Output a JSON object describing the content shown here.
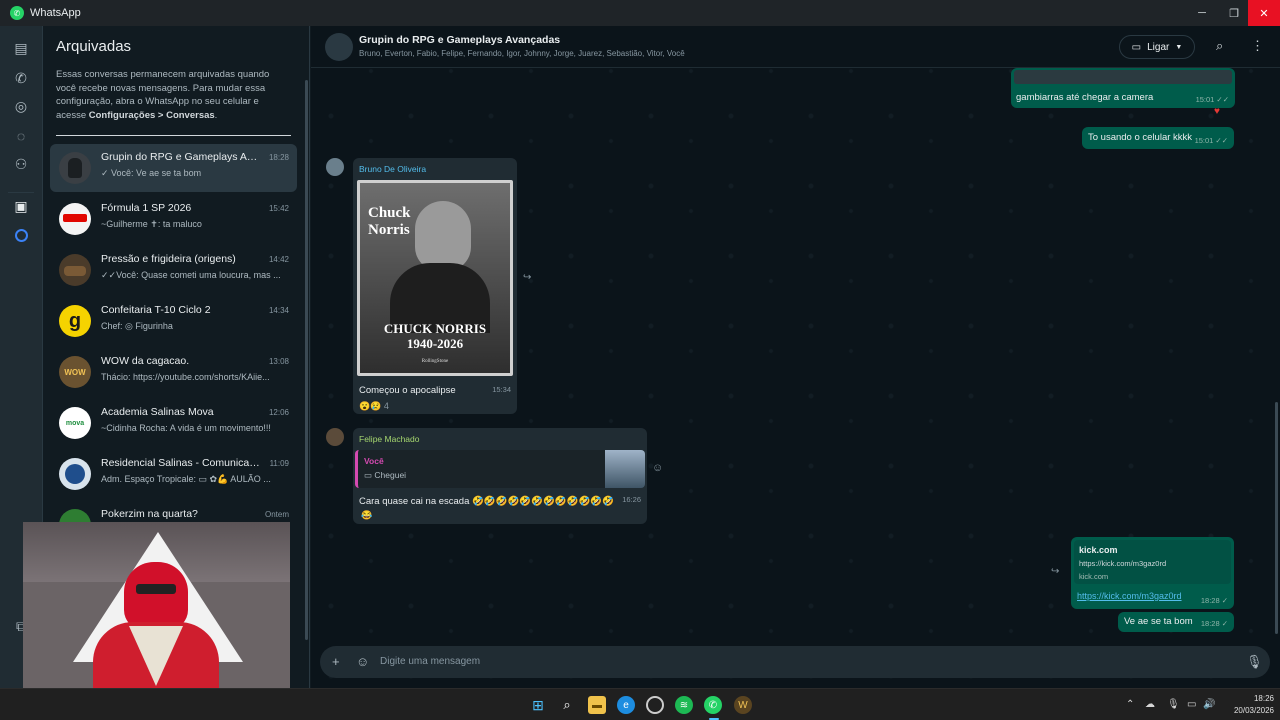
{
  "window": {
    "title": "WhatsApp"
  },
  "sidebar": {
    "title": "Arquivadas",
    "info_text": "Essas conversas permanecem arquivadas quando você recebe novas mensagens. Para mudar essa configuração, abra o WhatsApp no seu celular e acesse ",
    "info_bold": "Configurações > Conversas",
    "info_end": ".",
    "chats": [
      {
        "name": "Grupin do RPG e Gameplays Ava...",
        "time": "18:28",
        "last": "✓ Você: Ve ae se ta bom"
      },
      {
        "name": "Fórmula 1 SP 2026",
        "time": "15:42",
        "last": "~Guilherme ✝: ta maluco"
      },
      {
        "name": "Pressão e frigideira (origens)",
        "time": "14:42",
        "last": "✓✓Você: Quase cometi uma loucura, mas ..."
      },
      {
        "name": "Confeitaria T-10 Ciclo 2",
        "time": "14:34",
        "last": "Chef: ◎ Figurinha"
      },
      {
        "name": "WOW da cagacao.",
        "time": "13:08",
        "last": "Thácio: https://youtube.com/shorts/KAiie..."
      },
      {
        "name": "Academia Salinas Mova",
        "time": "12:06",
        "last": "~Cidinha Rocha: A vida é um movimento!!!"
      },
      {
        "name": "Residencial Salinas - Comunicad...",
        "time": "11:09",
        "last": "Adm. Espaço Tropicale: ▭ ✿💪 AULÃO ..."
      },
      {
        "name": "Pokerzim na quarta?",
        "time": "Ontem",
        "last": ""
      }
    ]
  },
  "header": {
    "group_name": "Grupin do RPG e Gameplays Avançadas",
    "members": "Bruno, Everton, Fabio, Felipe, Fernando, Igor, Johnny, Jorge, Juarez, Sebastião, Vitor, Você",
    "call_label": "Ligar"
  },
  "messages": {
    "m1_text": "gambiarras até chegar a camera",
    "m1_time": "15:01 ✓✓",
    "m2_text": "To usando o celular kkkk",
    "m2_time": "15:01 ✓✓",
    "m3_sender": "Bruno De Oliveira",
    "m3_poster_title1": "Chuck",
    "m3_poster_title2": "Norris",
    "m3_poster_caption1": "CHUCK NORRIS",
    "m3_poster_caption2": "1940-2026",
    "m3_poster_brand": "RollingStone",
    "m3_text": "Começou o apocalipse",
    "m3_time": "15:34",
    "m3_reactions": "😮😢 4",
    "m4_sender": "Felipe Machado",
    "m4_quote_author": "Você",
    "m4_quote_text": "▭ Cheguei",
    "m4_text": "Cara quase cai na escada 🤣🤣🤣🤣🤣🤣🤣🤣🤣🤣🤣🤣",
    "m4_time": "16:26",
    "m4_reactions": "😂",
    "m5_title": "kick.com",
    "m5_desc": "https://kick.com/m3gaz0rd",
    "m5_domain": "kick.com",
    "m5_link": "https://kick.com/m3gaz0rd",
    "m5_time": "18:28 ✓",
    "m6_text": "Ve ae se ta bom",
    "m6_time": "18:28 ✓"
  },
  "composer": {
    "placeholder": "Digite uma mensagem"
  },
  "taskbar": {
    "time": "18:26",
    "date": "20/03/2026"
  }
}
